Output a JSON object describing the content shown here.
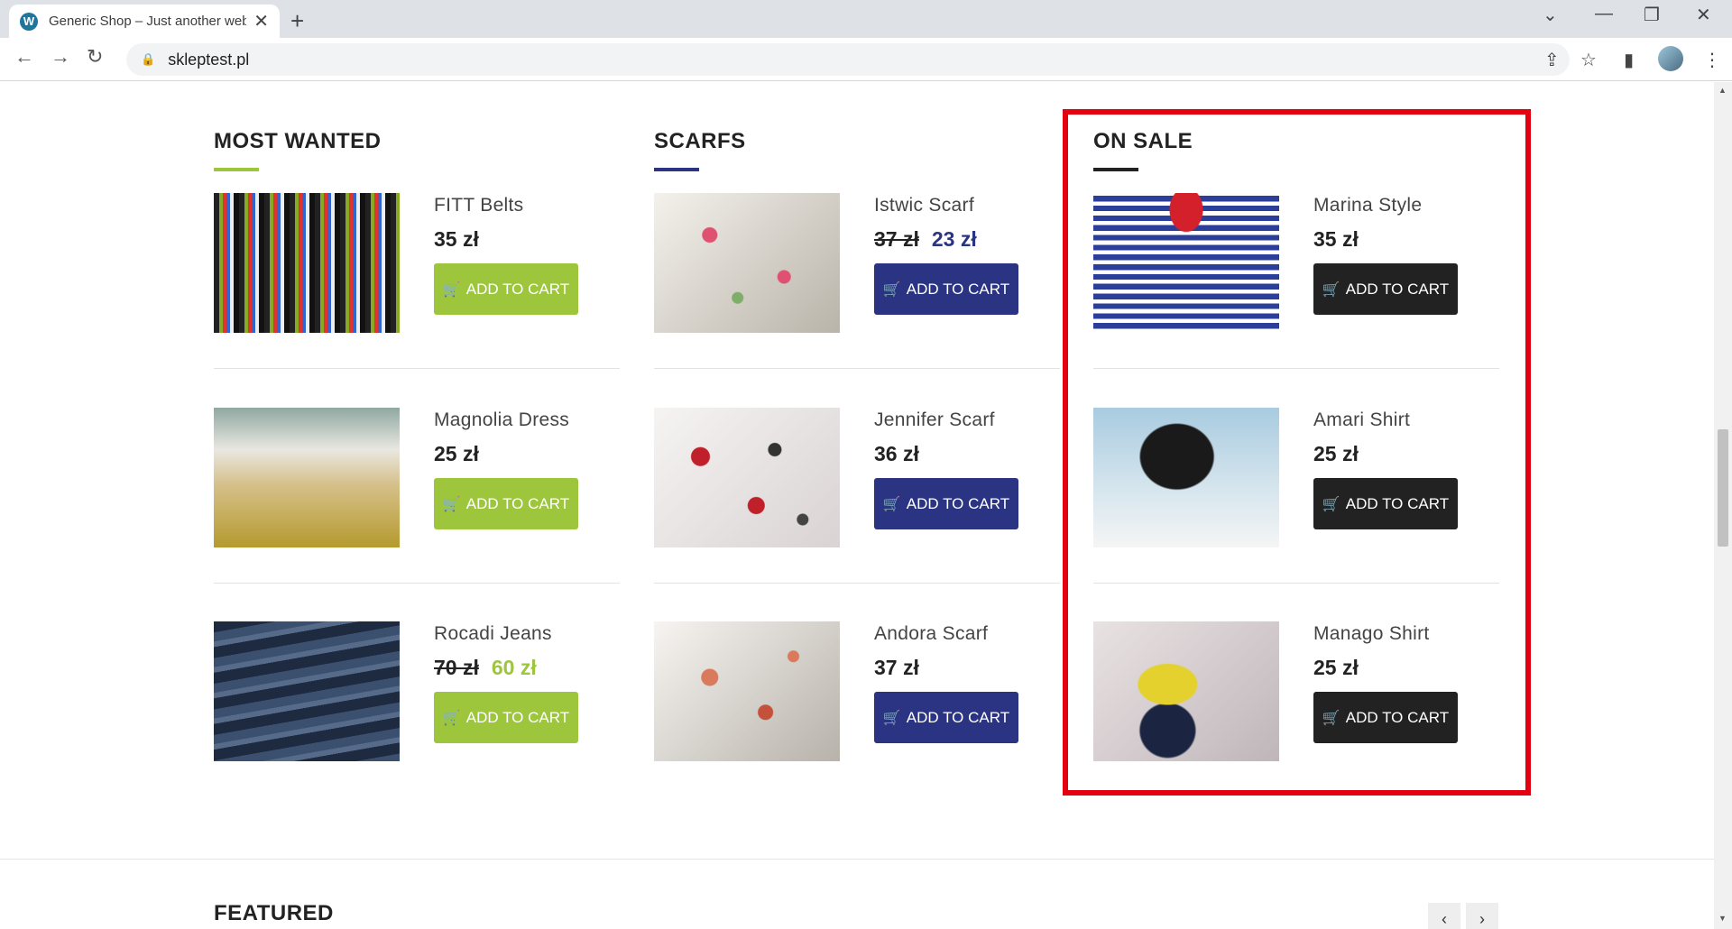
{
  "browser": {
    "tab_title": "Generic Shop – Just another web",
    "url": "skleptest.pl"
  },
  "colors": {
    "green": "#9dc63d",
    "navy": "#2a3483",
    "black": "#222222",
    "red_highlight": "#e3000f"
  },
  "columns": [
    {
      "title": "MOST WANTED",
      "items": [
        {
          "name": "FITT Belts",
          "price": "35 zł",
          "old_price": "",
          "button": "ADD TO CART"
        },
        {
          "name": "Magnolia Dress",
          "price": "25 zł",
          "old_price": "",
          "button": "ADD TO CART"
        },
        {
          "name": "Rocadi Jeans",
          "price": "60 zł",
          "old_price": "70 zł",
          "button": "ADD TO CART"
        }
      ]
    },
    {
      "title": "SCARFS",
      "items": [
        {
          "name": "Istwic Scarf",
          "price": "23 zł",
          "old_price": "37 zł",
          "button": "ADD TO CART"
        },
        {
          "name": "Jennifer Scarf",
          "price": "36 zł",
          "old_price": "",
          "button": "ADD TO CART"
        },
        {
          "name": "Andora Scarf",
          "price": "37 zł",
          "old_price": "",
          "button": "ADD TO CART"
        }
      ]
    },
    {
      "title": "ON SALE",
      "items": [
        {
          "name": "Marina Style",
          "price": "35 zł",
          "old_price": "",
          "button": "ADD TO CART"
        },
        {
          "name": "Amari Shirt",
          "price": "25 zł",
          "old_price": "",
          "button": "ADD TO CART"
        },
        {
          "name": "Manago Shirt",
          "price": "25 zł",
          "old_price": "",
          "button": "ADD TO CART"
        }
      ]
    }
  ],
  "featured": {
    "title": "FEATURED",
    "prev_icon": "‹",
    "next_icon": "›"
  }
}
